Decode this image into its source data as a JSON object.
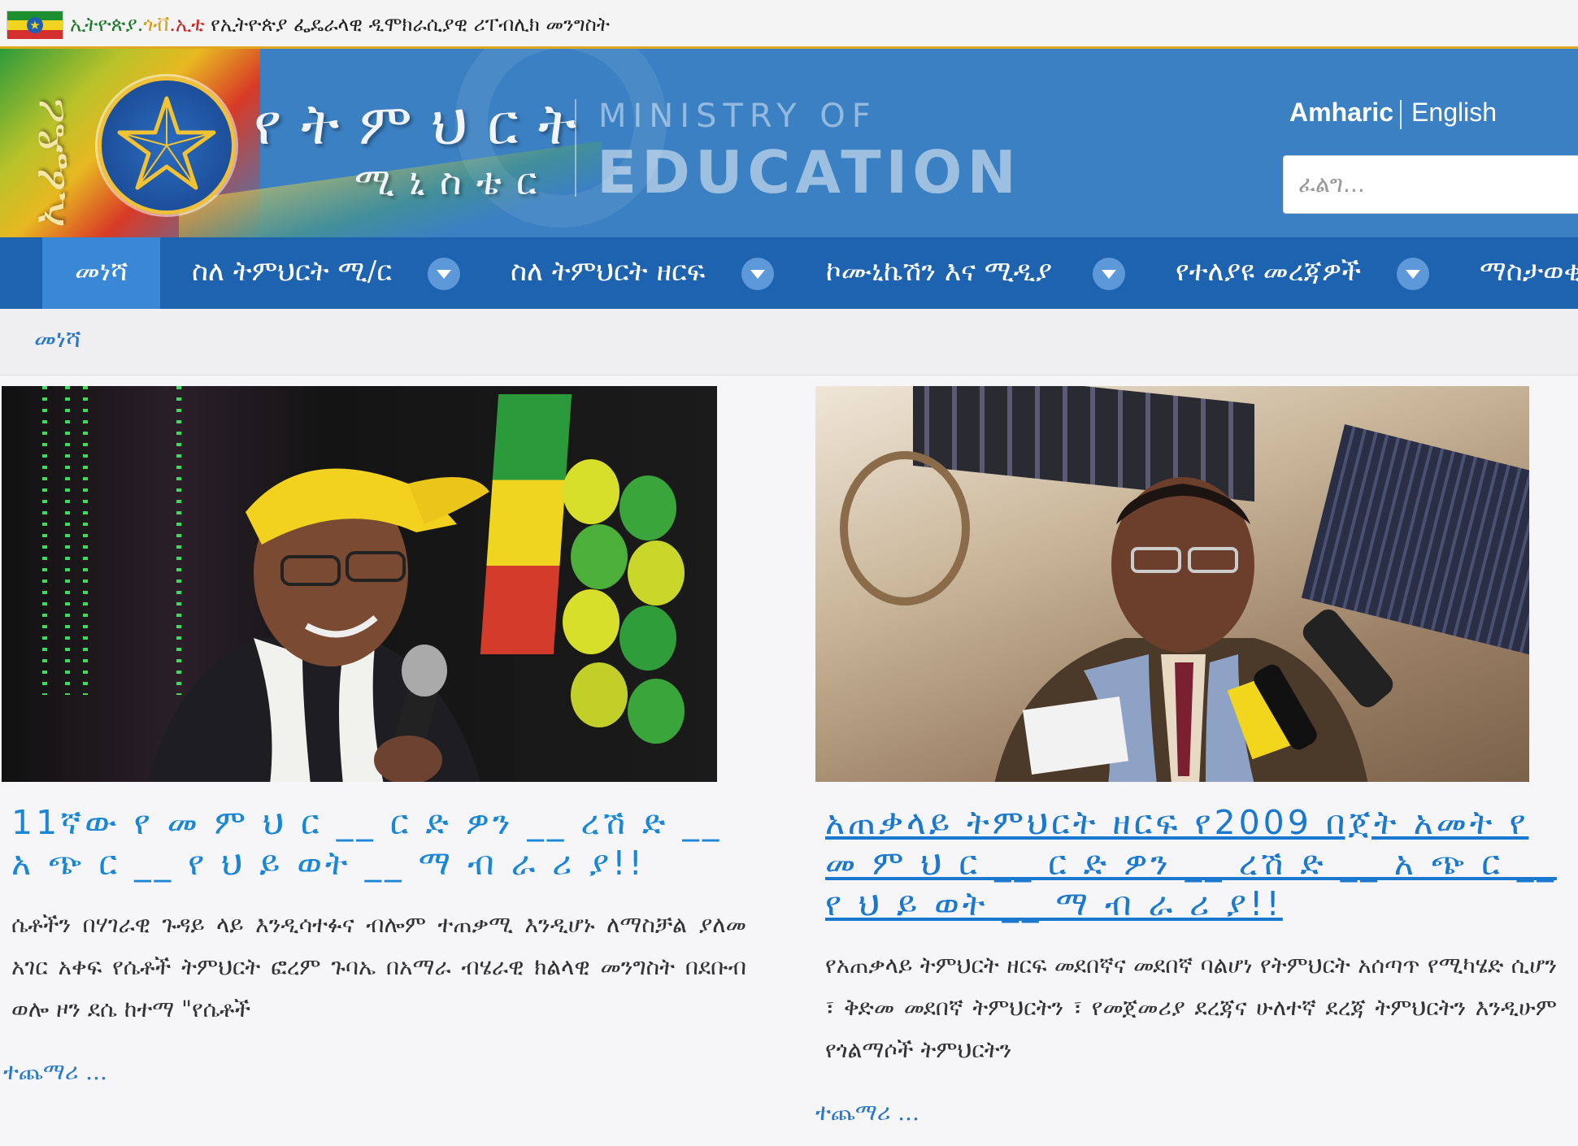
{
  "gov_bar": {
    "text_part1": "ኢትዮጵያ.",
    "text_part2": "ጎቭ",
    "text_part3": ".ኢቲ",
    "text_part4": " የኢትዮጵያ ፌዴራላዊ ዲሞክራሲያዊ ሪፐብሊክ መንግስት"
  },
  "header": {
    "vertical_text": "ኢፌዴሪ",
    "logo_amharic_line1": "የትምህርት",
    "logo_amharic_line2": "ሚኒስቴር",
    "logo_english_line1": "MINISTRY OF",
    "logo_english_line2": "EDUCATION",
    "lang_active": "Amharic",
    "lang_other": "English",
    "search_placeholder": "ፈልግ..."
  },
  "nav": {
    "items": [
      {
        "label": "መነሻ",
        "active": true
      },
      {
        "label": "ስለ ትምህርት ሚ/ር"
      },
      {
        "label": "ስለ ትምህርት ዘርፍ"
      },
      {
        "label": "ኮሙኒኬሽን እና ሚዲያ"
      },
      {
        "label": "የተለያዩ መረጃዎች"
      },
      {
        "label": "ማስታወቂ"
      }
    ]
  },
  "breadcrumb": {
    "label": "መነሻ"
  },
  "articles": [
    {
      "title": "11ኛው የ መ ም ህ ር __ ር ድ ዎን __ ረሽ ድ __ አ ጭ ር __ የ ህ ይ ወት __ ማ ብ ራ ሪ ያ!!",
      "body": "ሴቶችን በሃገራዊ ጉዳይ ላይ እንዲሳተፉና ብሎም ተጠቃሚ እንዲሆኑ ለማስቻል ያለመ አገር አቀፍ የሴቶች ትምህርት ፎረም ጉባኤ በአማራ ብሄራዊ ክልላዊ መንግስት በደቡብ ወሎ ዞን ደሴ ከተማ \"የሴቶች",
      "more": "ተጨማሪ ..."
    },
    {
      "title": "አጠቃላይ ትምህርት ዘርፍ የ2009 በጀት አመት የ መ ም ህ ር __ ር ድ ዎን __ ረሽ ድ __ አ ጭ ር __ የ ህ ይ ወት __ ማ ብ ራ ሪ ያ!!",
      "body": "የአጠቃላይ ትምህርት ዘርፍ መደበኛና መደበኛ ባልሆነ የትምህርት አሰጣጥ የሚካሄድ ሲሆን ፣ ቅድመ መደበኛ ትምህርትን ፣ የመጀመሪያ ደረጃና ሁለተኛ ደረጃ ትምህርትን እንዲሁም የጎልማሶች ትምህርትን",
      "more": "ተጨማሪ ..."
    }
  ],
  "colors": {
    "header_blue": "#3b80c3",
    "nav_blue": "#1e63b0",
    "nav_active": "#3a87d6",
    "link_blue": "#1a87d6",
    "gov_underline": "#e0a81e"
  }
}
